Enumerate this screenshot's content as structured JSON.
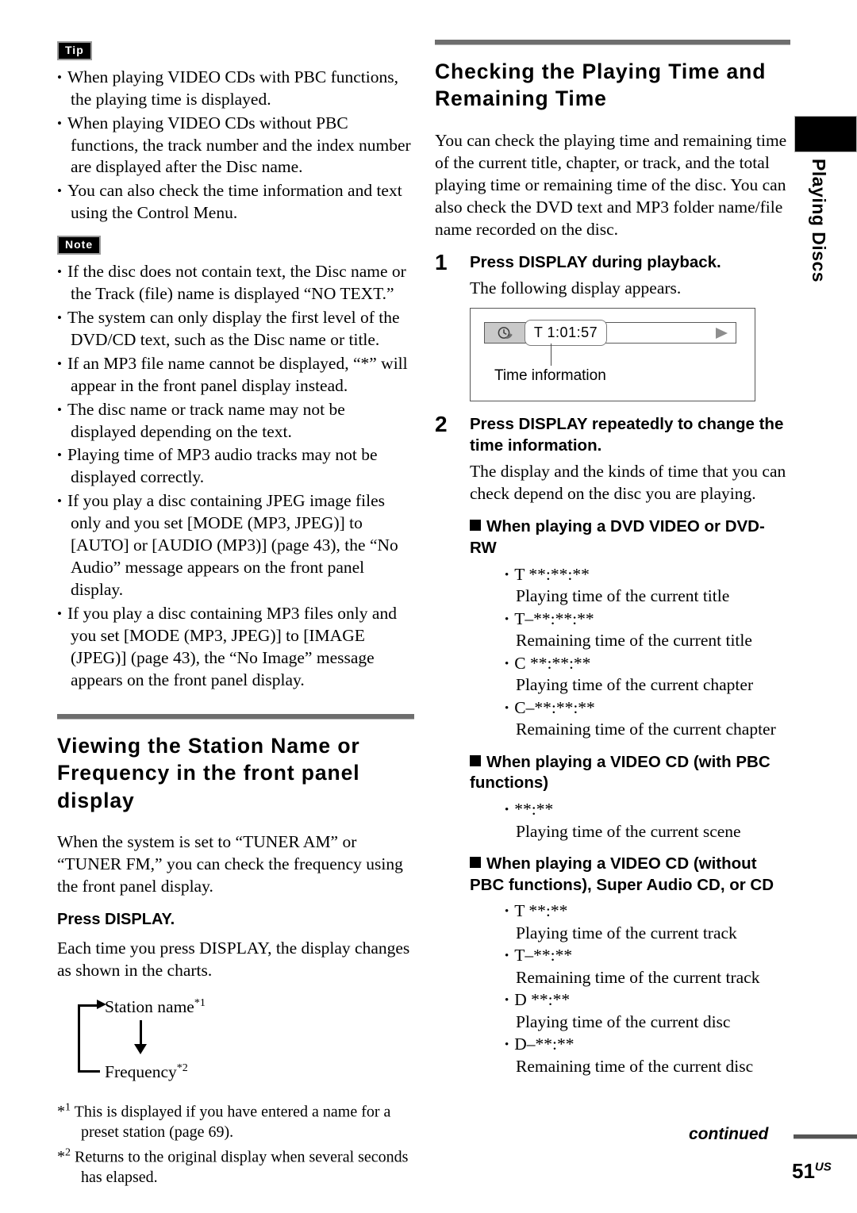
{
  "page": {
    "number": "51",
    "region_suffix": "US",
    "continued_label": "continued",
    "side_tab_label": "Playing Discs"
  },
  "left_column": {
    "tip": {
      "badge": "Tip",
      "items": [
        "When playing VIDEO CDs with PBC functions, the playing time is displayed.",
        "When playing VIDEO CDs without PBC functions, the track number and the index number are displayed after the Disc name.",
        "You can also check the time information and text using the Control Menu."
      ]
    },
    "note": {
      "badge": "Note",
      "items": [
        "If the disc does not contain text, the Disc name or the Track (file) name is displayed “NO TEXT.”",
        "The system can only display the first level of the DVD/CD text, such as the Disc name or title.",
        "If an MP3 file name cannot be displayed, “*” will appear in the front panel display instead.",
        "The disc name or track name may not be displayed depending on the text.",
        "Playing time of MP3 audio tracks may not be displayed correctly.",
        "If you play a disc containing JPEG image files only and you set [MODE (MP3, JPEG)] to [AUTO] or [AUDIO (MP3)] (page 43), the “No Audio” message appears on the front panel display.",
        "If you play a disc containing MP3 files only and you set [MODE (MP3, JPEG)] to [IMAGE (JPEG)] (page 43), the “No Image” message appears on the front panel display."
      ]
    },
    "section": {
      "title": "Viewing the Station Name or Frequency in the front panel display",
      "intro": "When the system is set to “TUNER AM” or “TUNER FM,” you can check the frequency using the front panel display.",
      "instruction": "Press DISPLAY.",
      "instruction_body": "Each time you press DISPLAY, the display changes as shown in the charts.",
      "flow": {
        "top_label": "Station name",
        "top_marker": "*1",
        "bottom_label": "Frequency",
        "bottom_marker": "*2"
      },
      "footnotes": [
        {
          "marker": "*",
          "sup": "1",
          "text": "This is displayed if you have entered a name for a preset station (page 69)."
        },
        {
          "marker": "*",
          "sup": "2",
          "text": "Returns to the original display when several seconds has elapsed."
        }
      ]
    }
  },
  "right_column": {
    "section": {
      "title": "Checking the Playing Time and Remaining Time",
      "intro": "You can check the playing time and remaining time of the current title, chapter, or track, and the total playing time or remaining time of the disc. You can also check the DVD text and MP3 folder name/file name recorded on the disc."
    },
    "steps": [
      {
        "number": "1",
        "title": "Press DISPLAY during playback.",
        "body": "The following display appears."
      },
      {
        "number": "2",
        "title": "Press DISPLAY repeatedly to change the time information.",
        "body": "The display and the kinds of time that you can check depend on the disc you are playing."
      }
    ],
    "display_diagram": {
      "icon_name": "clock-disc-icon",
      "time_value": "T  1:01:57",
      "play_icon_name": "play-triangle-icon",
      "callout_label": "Time information"
    },
    "disc_sections": [
      {
        "heading": "When playing a DVD VIDEO or DVD-RW",
        "entries": [
          {
            "code": "T **:**:**",
            "desc": "Playing time of the current title"
          },
          {
            "code": "T–**:**:**",
            "desc": "Remaining time of the current title"
          },
          {
            "code": "C **:**:**",
            "desc": "Playing time of the current chapter"
          },
          {
            "code": "C–**:**:**",
            "desc": "Remaining time of the current chapter"
          }
        ]
      },
      {
        "heading": "When playing a VIDEO CD (with PBC functions)",
        "entries": [
          {
            "code": "**:**",
            "desc": "Playing time of the current scene"
          }
        ]
      },
      {
        "heading": "When playing a VIDEO CD (without PBC functions), Super Audio CD, or CD",
        "entries": [
          {
            "code": "T **:**",
            "desc": "Playing time of the current track"
          },
          {
            "code": "T–**:**",
            "desc": "Remaining time of the current track"
          },
          {
            "code": "D **:**",
            "desc": "Playing time of the current disc"
          },
          {
            "code": "D–**:**",
            "desc": "Remaining time of the current disc"
          }
        ]
      }
    ]
  }
}
